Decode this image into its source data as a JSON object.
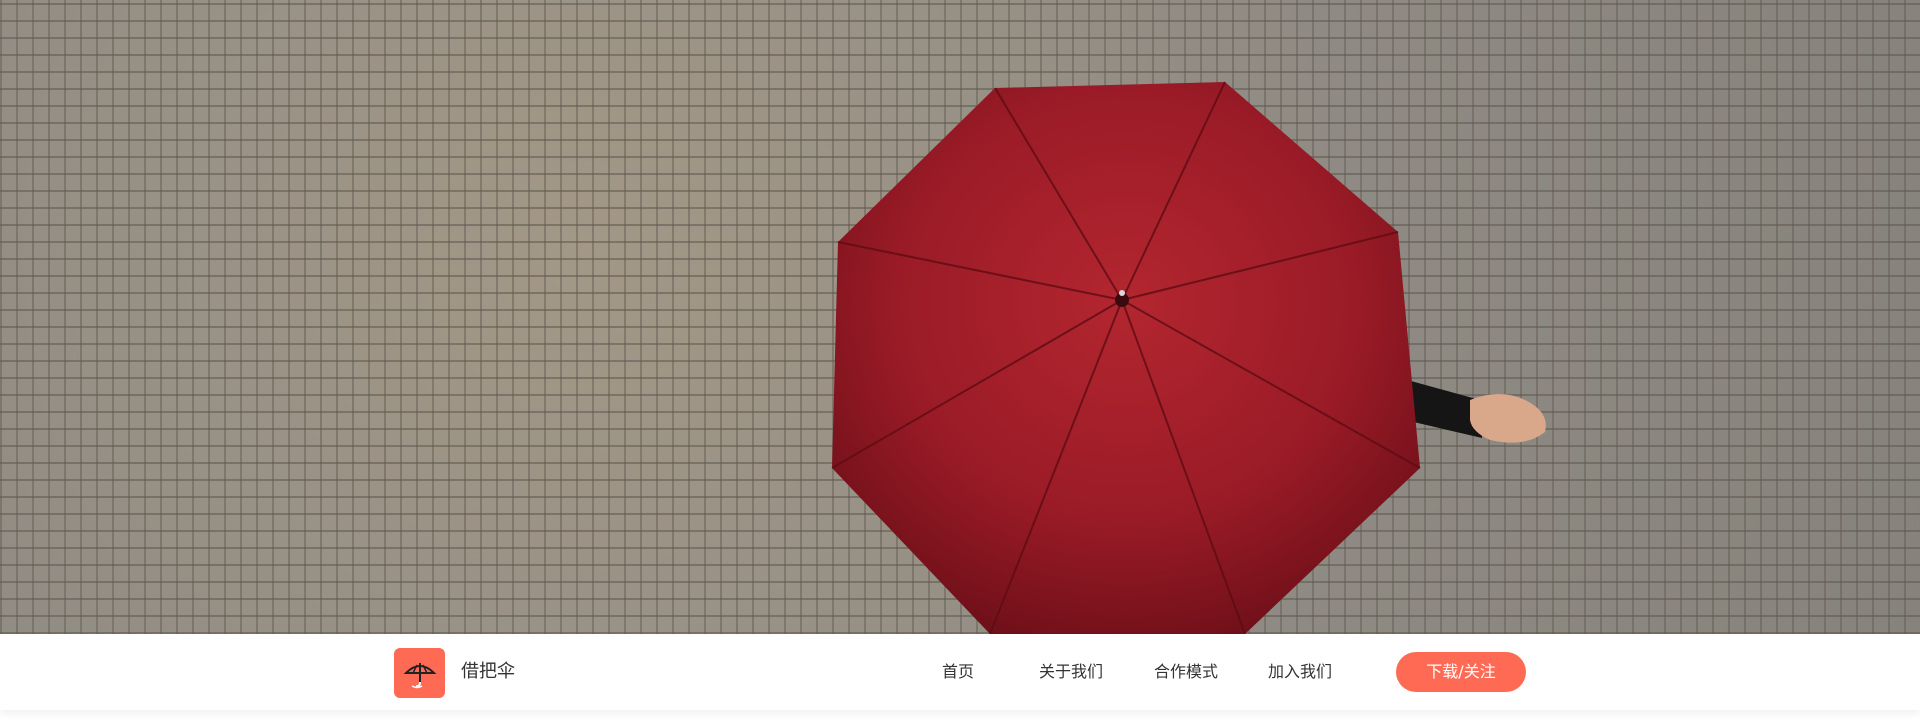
{
  "hero": {
    "image": "red-umbrella-over-cobblestone-photo",
    "umbrella_color": "#a11d2c",
    "ground_color": "#8f8a82"
  },
  "navbar": {
    "logo_icon": "umbrella-icon",
    "brand_name": "借把伞",
    "items": [
      {
        "label": "首页"
      },
      {
        "label": "关于我们"
      },
      {
        "label": "合作模式"
      },
      {
        "label": "加入我们"
      }
    ],
    "cta_label": "下载/关注",
    "accent_color": "#ff6a55"
  }
}
